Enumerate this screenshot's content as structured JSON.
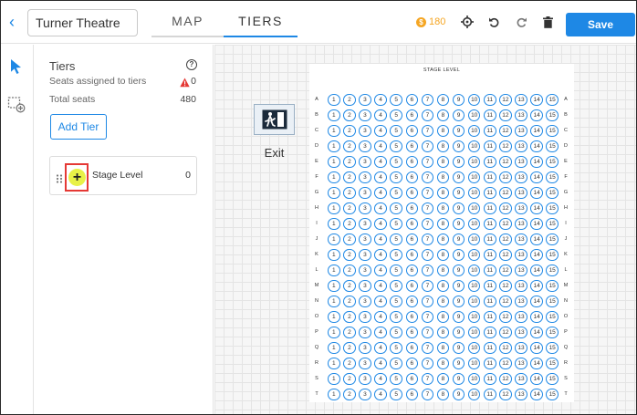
{
  "header": {
    "back_icon": "chevron-left-icon",
    "venue_name": "Turner Theatre",
    "tabs": [
      {
        "label": "MAP",
        "active": false
      },
      {
        "label": "TIERS",
        "active": true
      }
    ],
    "coin_badge": "$",
    "coin_count": "180",
    "tools": [
      "crosshair-icon",
      "undo-icon",
      "redo-icon",
      "trash-icon"
    ],
    "save_label": "Save",
    "accent_color": "#1e88e5"
  },
  "rail": {
    "items": [
      {
        "icon": "pointer-icon"
      },
      {
        "icon": "add-section-icon"
      }
    ]
  },
  "tiers_panel": {
    "title": "Tiers",
    "seats_assigned_label": "Seats assigned to tiers",
    "seats_assigned_value": "0",
    "total_seats_label": "Total seats",
    "total_seats_value": "480",
    "add_tier_label": "Add Tier",
    "tiers": [
      {
        "name": "Stage Level",
        "count": "0",
        "add_symbol": "+"
      }
    ]
  },
  "canvas": {
    "exit_label": "Exit",
    "section": {
      "name": "STAGE LEVEL",
      "rows": [
        "A",
        "B",
        "C",
        "D",
        "E",
        "F",
        "G",
        "H",
        "I",
        "J",
        "K",
        "L",
        "M",
        "N",
        "O",
        "P",
        "Q",
        "R",
        "S",
        "T"
      ],
      "seats_per_row": [
        "1",
        "2",
        "3",
        "4",
        "5",
        "6",
        "7",
        "8",
        "9",
        "10",
        "11",
        "12",
        "13",
        "14",
        "15"
      ]
    }
  }
}
